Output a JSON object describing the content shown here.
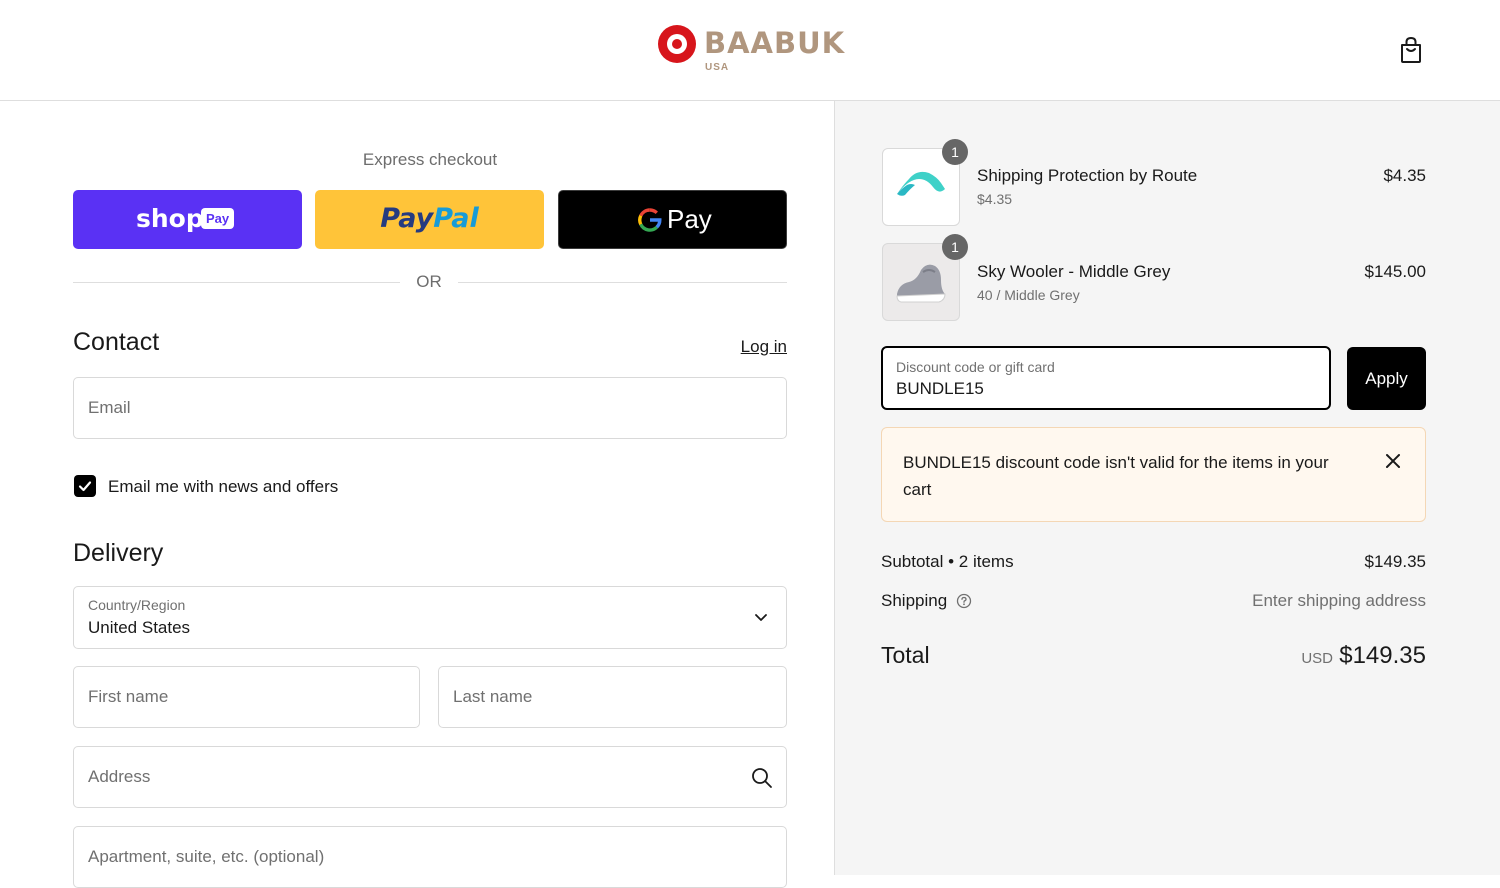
{
  "header": {
    "brand": "BAABUK",
    "brand_sub": "USA",
    "cart_icon": "shopping-bag-icon"
  },
  "express": {
    "label": "Express checkout",
    "shop_label": "shop",
    "shop_pay_badge": "Pay",
    "paypal_part1": "Pay",
    "paypal_part2": "Pal",
    "gpay_label": "Pay",
    "or_label": "OR"
  },
  "contact": {
    "title": "Contact",
    "login_label": "Log in",
    "email_placeholder": "Email",
    "newsletter_label": "Email me with news and offers",
    "newsletter_checked": true
  },
  "delivery": {
    "title": "Delivery",
    "country_label": "Country/Region",
    "country_value": "United States",
    "first_name_placeholder": "First name",
    "last_name_placeholder": "Last name",
    "address_placeholder": "Address",
    "apartment_placeholder": "Apartment, suite, etc. (optional)"
  },
  "summary": {
    "items": [
      {
        "qty": "1",
        "name": "Shipping Protection by Route",
        "sub": "$4.35",
        "price": "$4.35",
        "image": "route-logo"
      },
      {
        "qty": "1",
        "name": "Sky Wooler - Middle Grey",
        "sub": "40 / Middle Grey",
        "price": "$145.00",
        "image": "grey-sneaker"
      }
    ],
    "discount_label": "Discount code or gift card",
    "discount_value": "BUNDLE15",
    "apply_label": "Apply",
    "error_message": "BUNDLE15 discount code isn't valid for the items in your cart",
    "subtotal_label": "Subtotal • 2 items",
    "subtotal_value": "$149.35",
    "shipping_label": "Shipping",
    "shipping_value": "Enter shipping address",
    "total_label": "Total",
    "total_currency": "USD",
    "total_value": "$149.35"
  },
  "colors": {
    "shop_pay": "#5a31f4",
    "paypal": "#ffc439",
    "gpay": "#000000",
    "brand_red": "#d7151b",
    "error_bg": "#fff8ef"
  }
}
